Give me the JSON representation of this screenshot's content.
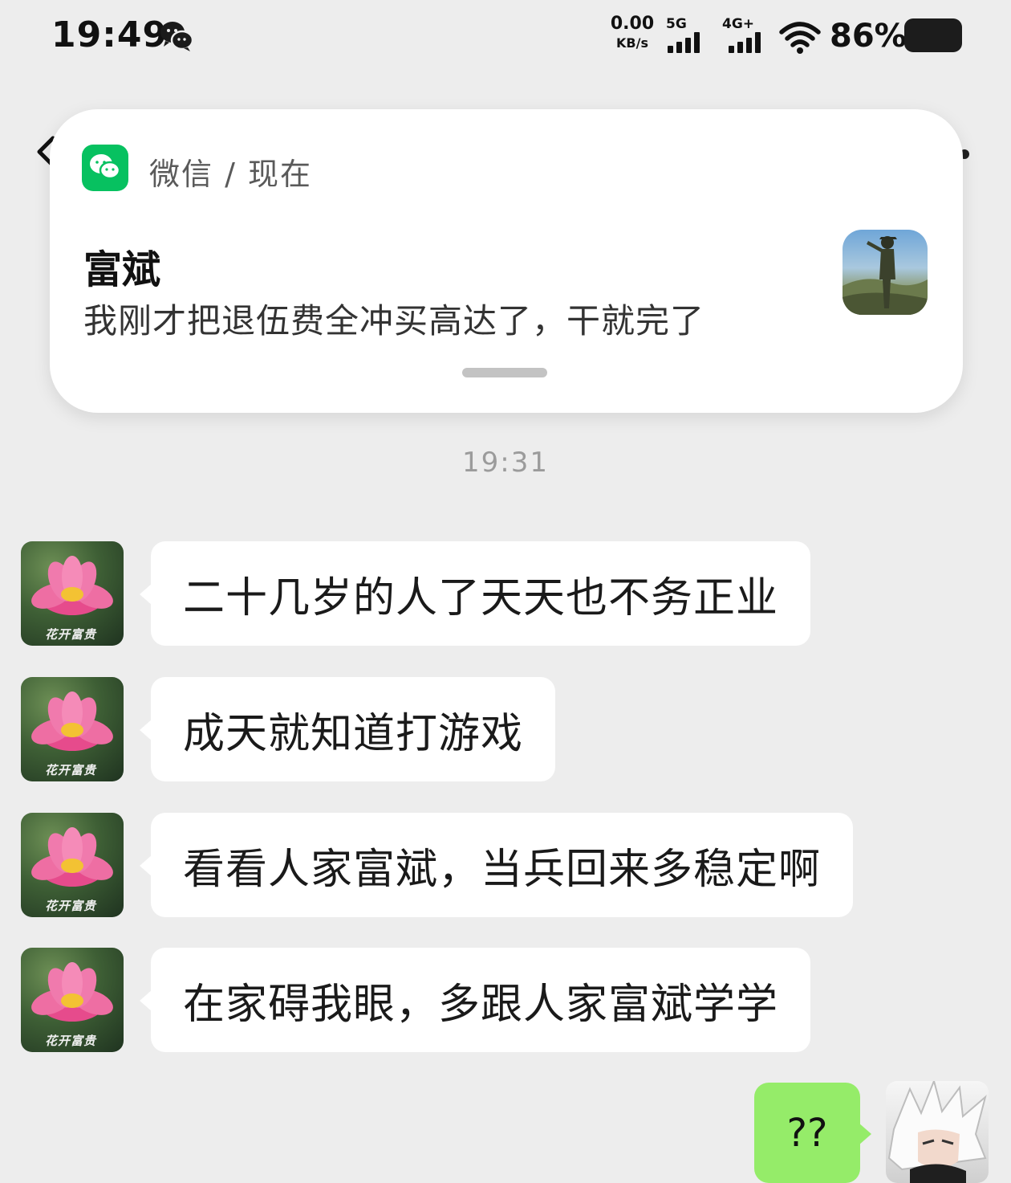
{
  "status_bar": {
    "time": "19:49",
    "net_speed_value": "0.00",
    "net_speed_unit": "KB/s",
    "signal_1_label": "5G",
    "signal_2_label": "4G+",
    "battery_percent": "86%"
  },
  "notification": {
    "source": "微信 / 现在",
    "sender": "富斌",
    "message": "我刚才把退伍费全冲买高达了，干就完了",
    "app_icon": "wechat-icon",
    "accent_color": "#07c160"
  },
  "chat": {
    "timestamp": "19:31",
    "incoming": [
      {
        "text": "二十几岁的人了天天也不务正业"
      },
      {
        "text": "成天就知道打游戏"
      },
      {
        "text": "看看人家富斌，当兵回来多稳定啊"
      },
      {
        "text": "在家碍我眼，多跟人家富斌学学"
      }
    ],
    "incoming_avatar_caption": "花开富贵",
    "outgoing": [
      {
        "text": "??"
      }
    ],
    "bubble_color_incoming": "#ffffff",
    "bubble_color_outgoing": "#95ec69"
  }
}
